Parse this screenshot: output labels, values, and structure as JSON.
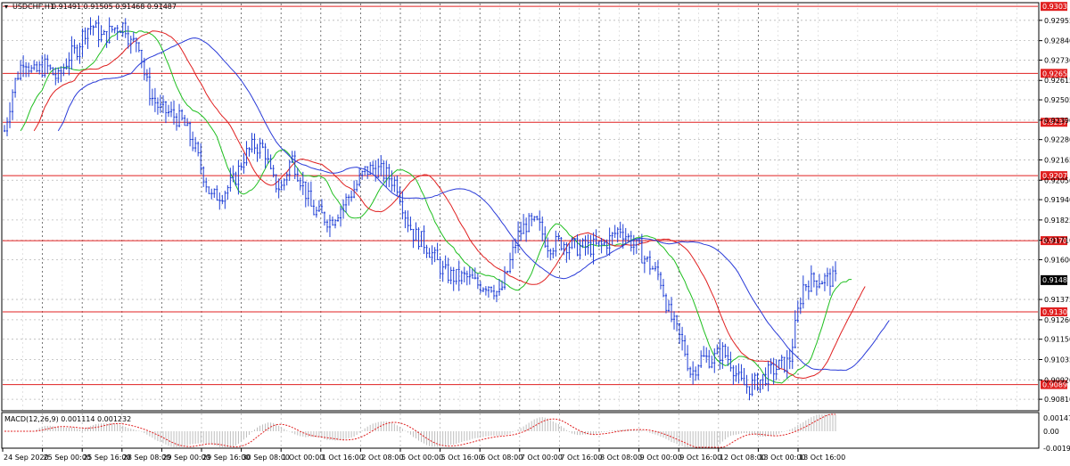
{
  "header": {
    "symbol_text": "USDCHF,H1",
    "ohlc_text": "0.91491 0.91505 0.91468 0.91487"
  },
  "macd": {
    "label": "MACD(12,26,9) 0.001114 0.001232",
    "ticks": [
      "0.001471",
      "0.00",
      "-0.00195"
    ]
  },
  "colors": {
    "candle": "#1f3fd6",
    "ma_fast": "#1fbf1f",
    "ma_mid": "#e02020",
    "ma_slow": "#2a3bd8",
    "level": "#e02020",
    "grid": "#b8b8b8",
    "current_price_bg": "#000000",
    "macd_hist": "#bdbdbd",
    "macd_signal": "#e02020"
  },
  "chart_data": {
    "type": "candlestick",
    "symbol": "USDCHF",
    "timeframe": "H1",
    "current_price": 0.91487,
    "ylim": [
      0.9075,
      0.9305
    ],
    "grid": true,
    "y_ticks": [
      "0.92955",
      "0.92840",
      "0.92730",
      "0.92615",
      "0.92505",
      "0.92390",
      "0.92280",
      "0.92165",
      "0.92050",
      "0.91940",
      "0.91825",
      "0.91710",
      "0.91600",
      "0.91375",
      "0.91260",
      "0.91150",
      "0.91035",
      "0.90920",
      "0.90810"
    ],
    "x_ticks": [
      "24 Sep 2020",
      "25 Sep 00:00",
      "25 Sep 16:00",
      "28 Sep 08:00",
      "29 Sep 00:00",
      "29 Sep 16:00",
      "30 Sep 08:00",
      "1 Oct 00:00",
      "1 Oct 16:00",
      "2 Oct 08:00",
      "5 Oct 00:00",
      "5 Oct 16:00",
      "6 Oct 08:00",
      "7 Oct 00:00",
      "7 Oct 16:00",
      "8 Oct 08:00",
      "9 Oct 00:00",
      "9 Oct 16:00",
      "12 Oct 08:00",
      "13 Oct 00:00",
      "13 Oct 16:00"
    ],
    "levels": [
      "0.93034",
      "0.92655",
      "0.92378",
      "0.92076",
      "0.91708",
      "0.91305",
      "0.90893"
    ],
    "price_path": [
      [
        0,
        0.9233
      ],
      [
        10,
        0.9258
      ],
      [
        22,
        0.9275
      ],
      [
        32,
        0.9265
      ],
      [
        46,
        0.927
      ],
      [
        60,
        0.9262
      ],
      [
        72,
        0.9275
      ],
      [
        80,
        0.9278
      ],
      [
        90,
        0.929
      ],
      [
        98,
        0.9293
      ],
      [
        110,
        0.9285
      ],
      [
        122,
        0.9291
      ],
      [
        135,
        0.9293
      ],
      [
        142,
        0.9282
      ],
      [
        150,
        0.9285
      ],
      [
        158,
        0.9262
      ],
      [
        165,
        0.9252
      ],
      [
        175,
        0.9245
      ],
      [
        185,
        0.9243
      ],
      [
        200,
        0.9238
      ],
      [
        212,
        0.9225
      ],
      [
        222,
        0.921
      ],
      [
        232,
        0.9195
      ],
      [
        245,
        0.9198
      ],
      [
        258,
        0.9205
      ],
      [
        268,
        0.9218
      ],
      [
        280,
        0.9225
      ],
      [
        292,
        0.9222
      ],
      [
        300,
        0.9205
      ],
      [
        310,
        0.92
      ],
      [
        322,
        0.9218
      ],
      [
        335,
        0.9202
      ],
      [
        345,
        0.9188
      ],
      [
        355,
        0.9185
      ],
      [
        365,
        0.9182
      ],
      [
        378,
        0.919
      ],
      [
        392,
        0.92
      ],
      [
        404,
        0.921
      ],
      [
        415,
        0.9212
      ],
      [
        428,
        0.9208
      ],
      [
        440,
        0.9203
      ],
      [
        450,
        0.9185
      ],
      [
        458,
        0.9175
      ],
      [
        470,
        0.917
      ],
      [
        480,
        0.9163
      ],
      [
        492,
        0.9153
      ],
      [
        505,
        0.915
      ],
      [
        518,
        0.915
      ],
      [
        530,
        0.9146
      ],
      [
        545,
        0.9146
      ],
      [
        555,
        0.914
      ],
      [
        565,
        0.9155
      ],
      [
        575,
        0.9173
      ],
      [
        585,
        0.918
      ],
      [
        598,
        0.918
      ],
      [
        610,
        0.9168
      ],
      [
        625,
        0.917
      ],
      [
        640,
        0.9167
      ],
      [
        655,
        0.9167
      ],
      [
        670,
        0.9168
      ],
      [
        680,
        0.9172
      ],
      [
        690,
        0.9178
      ],
      [
        700,
        0.9172
      ],
      [
        712,
        0.9165
      ],
      [
        722,
        0.9158
      ],
      [
        735,
        0.915
      ],
      [
        745,
        0.913
      ],
      [
        752,
        0.9122
      ],
      [
        762,
        0.911
      ],
      [
        770,
        0.9095
      ],
      [
        780,
        0.9104
      ],
      [
        795,
        0.9104
      ],
      [
        805,
        0.9108
      ],
      [
        815,
        0.9102
      ],
      [
        825,
        0.909
      ],
      [
        835,
        0.9088
      ],
      [
        848,
        0.9092
      ],
      [
        860,
        0.9097
      ],
      [
        870,
        0.91
      ],
      [
        880,
        0.9102
      ],
      [
        888,
        0.9125
      ],
      [
        895,
        0.9145
      ],
      [
        905,
        0.9148
      ],
      [
        915,
        0.9149
      ],
      [
        925,
        0.9149
      ],
      [
        932,
        0.91487
      ]
    ]
  }
}
